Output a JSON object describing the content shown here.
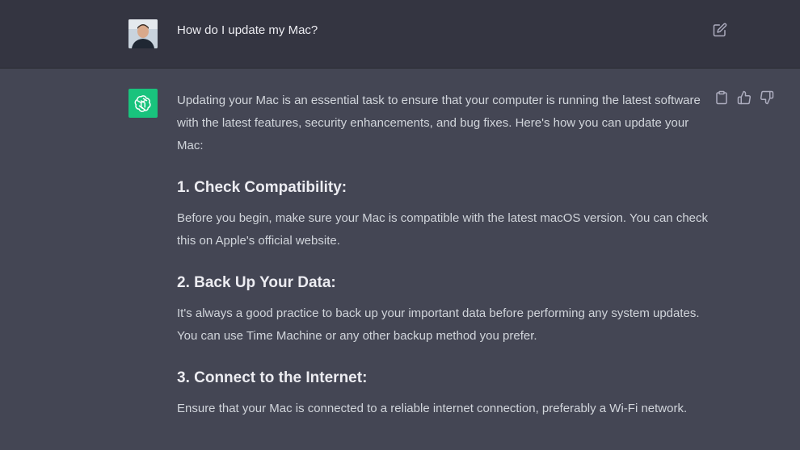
{
  "user_message": {
    "text": "How do I update my Mac?",
    "avatar": "user-photo",
    "edit_icon": "edit-icon"
  },
  "assistant_message": {
    "avatar_icon": "openai-logo-icon",
    "accent_color": "#19c37d",
    "intro": "Updating your Mac is an essential task to ensure that your computer is running the latest software with the latest features, security enhancements, and bug fixes. Here's how you can update your Mac:",
    "sections": [
      {
        "heading": "1. Check Compatibility:",
        "body": "Before you begin, make sure your Mac is compatible with the latest macOS version. You can check this on Apple's official website."
      },
      {
        "heading": "2. Back Up Your Data:",
        "body": "It's always a good practice to back up your important data before performing any system updates. You can use Time Machine or any other backup method you prefer."
      },
      {
        "heading": "3. Connect to the Internet:",
        "body": "Ensure that your Mac is connected to a reliable internet connection, preferably a Wi-Fi network."
      }
    ],
    "actions": [
      "clipboard-icon",
      "thumbs-up-icon",
      "thumbs-down-icon"
    ]
  },
  "colors": {
    "user_row_bg": "#343541",
    "assistant_row_bg": "#444654",
    "text": "#d1d5db",
    "heading": "#ececf1"
  }
}
